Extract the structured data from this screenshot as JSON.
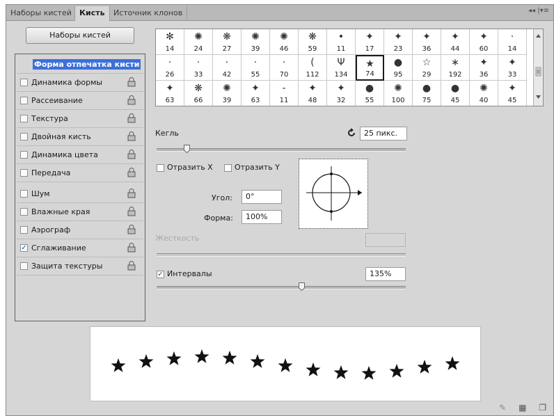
{
  "tabs": [
    {
      "label": "Наборы кистей",
      "active": false
    },
    {
      "label": "Кисть",
      "active": true
    },
    {
      "label": "Источник клонов",
      "active": false
    }
  ],
  "tabbar_controls": "◂◂  |▾≡",
  "presets_button": "Наборы кистей",
  "left_items": [
    {
      "label": "Форма отпечатка кисти",
      "selected": true
    },
    {
      "label": "Динамика формы",
      "checked": false
    },
    {
      "label": "Рассеивание",
      "checked": false
    },
    {
      "label": "Текстура",
      "checked": false
    },
    {
      "label": "Двойная кисть",
      "checked": false
    },
    {
      "label": "Динамика цвета",
      "checked": false
    },
    {
      "label": "Передача",
      "checked": false
    },
    {
      "label": "Шум",
      "checked": false
    },
    {
      "label": "Влажные края",
      "checked": false
    },
    {
      "label": "Аэрограф",
      "checked": false
    },
    {
      "label": "Сглаживание",
      "checked": true
    },
    {
      "label": "Защита текстуры",
      "checked": false
    }
  ],
  "brush_grid": [
    [
      "14",
      "24",
      "27",
      "39",
      "46",
      "59",
      "11",
      "17",
      "23",
      "36",
      "44",
      "60",
      "14"
    ],
    [
      "26",
      "33",
      "42",
      "55",
      "70",
      "112",
      "134",
      "74",
      "95",
      "29",
      "192",
      "36",
      "33"
    ],
    [
      "63",
      "66",
      "39",
      "63",
      "11",
      "48",
      "32",
      "55",
      "100",
      "75",
      "45",
      "40",
      "45"
    ]
  ],
  "brush_glyphs": [
    [
      "✻",
      "✺",
      "❋",
      "✺",
      "✺",
      "❋",
      "•",
      "✦",
      "✦",
      "✦",
      "✦",
      "✦",
      "·"
    ],
    [
      "·",
      "·",
      "·",
      "·",
      "·",
      "(",
      "Ψ",
      "★",
      "●",
      "☆",
      "∗",
      "✦",
      "✦"
    ],
    [
      "✦",
      "❋",
      "✺",
      "✦",
      "-",
      "✦",
      "✦",
      "●",
      "✺",
      "●",
      "●",
      "✺",
      "✦"
    ]
  ],
  "selected_brush": "74",
  "size": {
    "label": "Кегль",
    "value": "25 пикс.",
    "slider_fraction": 0.12
  },
  "flip_x": {
    "label": "Отразить X",
    "checked": false
  },
  "flip_y": {
    "label": "Отразить Y",
    "checked": false
  },
  "angle": {
    "label": "Угол:",
    "value": "0°"
  },
  "roundness": {
    "label": "Форма:",
    "value": "100%"
  },
  "hardness": {
    "label": "Жесткость",
    "value": "",
    "disabled": true
  },
  "spacing": {
    "label": "Интервалы",
    "checked": true,
    "value": "135%",
    "slider_fraction": 0.58
  },
  "footer_icons": [
    "brush-settings-icon",
    "grid-icon",
    "new-preset-icon"
  ],
  "colors": {
    "panel": "#d6d6d6",
    "highlight": "#3c70d8"
  }
}
